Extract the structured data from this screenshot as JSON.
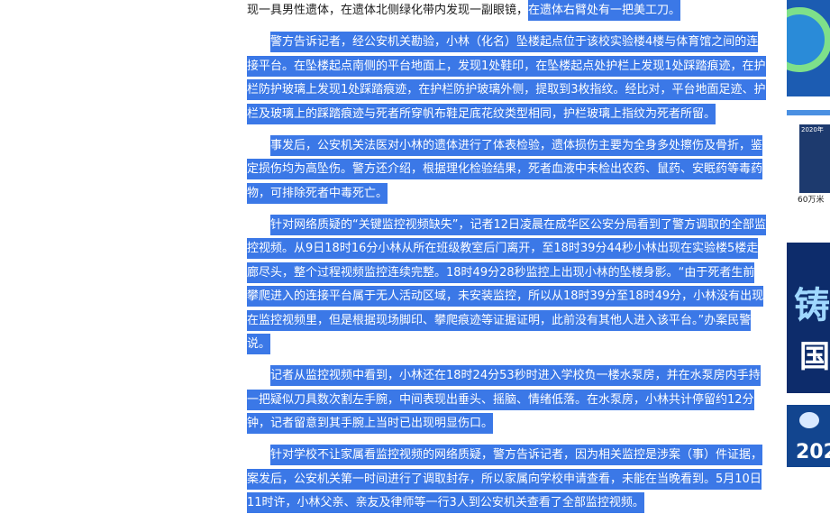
{
  "article": {
    "p0_plain": "现一具男性遗体，在遗体北侧绿化带内发现一副眼镜，",
    "p0_selected": "在遗体右臂处有一把美工刀。",
    "paragraphs": [
      "警方告诉记者，经公安机关勘验，小林（化名）坠楼起点位于该校实验楼4楼与体育馆之间的连接平台。在坠楼起点南侧的平台地面上，发现1处鞋印，在坠楼起点处护栏上发现1处踩踏痕迹，在护栏防护玻璃上发现1处踩踏痕迹，在护栏防护玻璃外侧，提取到3枚指纹。经比对，平台地面足迹、护栏及玻璃上的踩踏痕迹与死者所穿帆布鞋足底花纹类型相同，护栏玻璃上指纹为死者所留。",
      "事发后，公安机关法医对小林的遗体进行了体表检验，遗体损伤主要为全身多处擦伤及骨折，鉴定损伤均为高坠伤。警方还介绍，根据理化检验结果，死者血液中未检出农药、鼠药、安眠药等毒药物，可排除死者中毒死亡。",
      "针对网络质疑的“关键监控视频缺失”，记者12日凌晨在成华区公安分局看到了警方调取的全部监控视频。从9日18时16分小林从所在班级教室后门离开，至18时39分44秒小林出现在实验楼5楼走廊尽头，整个过程视频监控连续完整。18时49分28秒监控上出现小林的坠楼身影。“由于死者生前攀爬进入的连接平台属于无人活动区域，未安装监控，所以从18时39分至18时49分，小林没有出现在监控视频里，但是根据现场脚印、攀爬痕迹等证据证明，此前没有其他人进入该平台。”办案民警说。",
      "记者从监控视频中看到，小林还在18时24分53秒时进入学校负一楼水泵房，并在水泵房内手持一把疑似刀具数次割左手腕，中间表现出垂头、摇脑、情绪低落。在水泵房，小林共计停留约12分钟，记者留意到其手腕上当时已出现明显伤口。",
      "针对学校不让家属看监控视频的网络质疑，警方告诉记者，因为相关监控是涉案（事）件证据，案发后，公安机关第一时间进行了调取封存，所以家属向学校申请查看，未能在当晚看到。5月10日11时许，小林父亲、亲友及律师等一行3人到公安机关查看了全部监控视频。"
    ]
  },
  "sidebar": {
    "card2_year": "2020年",
    "card2_caption": "60万米",
    "card3_text_top": "铸",
    "card3_text_bottom": "国",
    "card4_year": "202"
  },
  "colors": {
    "selection": "#3b78e7",
    "selection_text": "#ffffff"
  }
}
